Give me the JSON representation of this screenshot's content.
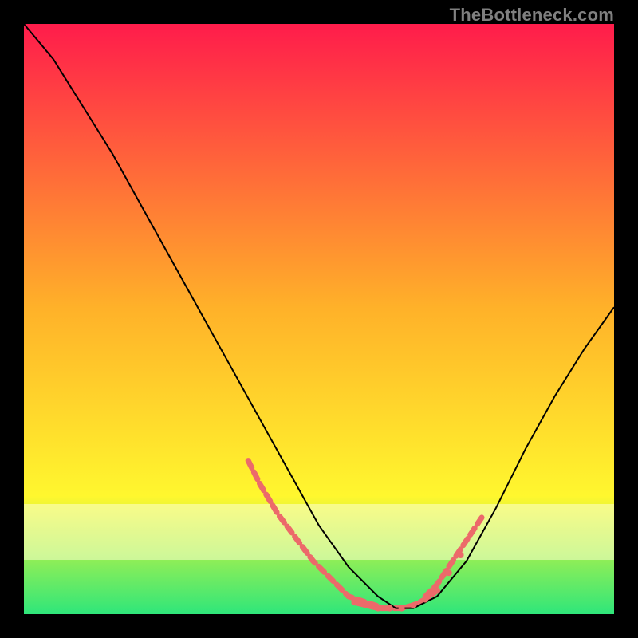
{
  "watermark": "TheBottleneck.com",
  "chart_data": {
    "type": "line",
    "title": "",
    "xlabel": "",
    "ylabel": "",
    "xlim": [
      0,
      100
    ],
    "ylim": [
      0,
      100
    ],
    "grid": false,
    "legend": false,
    "background_gradient": {
      "top": "#ff1c4b",
      "mid1": "#ffb129",
      "mid2": "#fff72e",
      "bottom": "#2fe67a"
    },
    "series": [
      {
        "name": "bottleneck-curve",
        "x": [
          0,
          5,
          10,
          15,
          20,
          25,
          30,
          35,
          40,
          45,
          50,
          55,
          60,
          63,
          66,
          70,
          75,
          80,
          85,
          90,
          95,
          100
        ],
        "y": [
          100,
          94,
          86,
          78,
          69,
          60,
          51,
          42,
          33,
          24,
          15,
          8,
          3,
          1,
          1,
          3,
          9,
          18,
          28,
          37,
          45,
          52
        ],
        "stroke": "#000000",
        "width": 2
      }
    ],
    "highlight_segments": [
      {
        "name": "lowlight-left",
        "x": [
          38,
          40,
          43,
          46,
          49,
          52,
          55,
          58,
          61
        ],
        "y": [
          26,
          22,
          17,
          13,
          9,
          6,
          3,
          2,
          1
        ],
        "stroke": "#ec6a6a",
        "width": 7,
        "dash": "10 6"
      },
      {
        "name": "lowlight-bottom",
        "x": [
          56,
          58,
          60,
          62,
          64,
          66,
          68,
          70
        ],
        "y": [
          2,
          1.5,
          1,
          1,
          1,
          1.5,
          2.5,
          4
        ],
        "stroke": "#ec6a6a",
        "width": 7,
        "dash": "12 5"
      },
      {
        "name": "lowlight-right",
        "x": [
          68,
          70,
          72,
          74,
          76,
          78
        ],
        "y": [
          3,
          5,
          8,
          11,
          14,
          17
        ],
        "stroke": "#ec6a6a",
        "width": 7,
        "dash": "10 6"
      }
    ],
    "dots": [
      {
        "x": 56,
        "y": 2,
        "r": 4,
        "fill": "#ec6a6a"
      },
      {
        "x": 58,
        "y": 1.5,
        "r": 4,
        "fill": "#ec6a6a"
      },
      {
        "x": 60,
        "y": 1,
        "r": 4,
        "fill": "#ec6a6a"
      },
      {
        "x": 62,
        "y": 1,
        "r": 4,
        "fill": "#ec6a6a"
      },
      {
        "x": 64,
        "y": 1,
        "r": 4,
        "fill": "#ec6a6a"
      },
      {
        "x": 66,
        "y": 1.5,
        "r": 4,
        "fill": "#ec6a6a"
      },
      {
        "x": 68,
        "y": 2.5,
        "r": 4,
        "fill": "#ec6a6a"
      },
      {
        "x": 70,
        "y": 4,
        "r": 4,
        "fill": "#ec6a6a"
      },
      {
        "x": 72,
        "y": 7,
        "r": 4,
        "fill": "#ec6a6a"
      },
      {
        "x": 74,
        "y": 10,
        "r": 4,
        "fill": "#ec6a6a"
      }
    ]
  }
}
